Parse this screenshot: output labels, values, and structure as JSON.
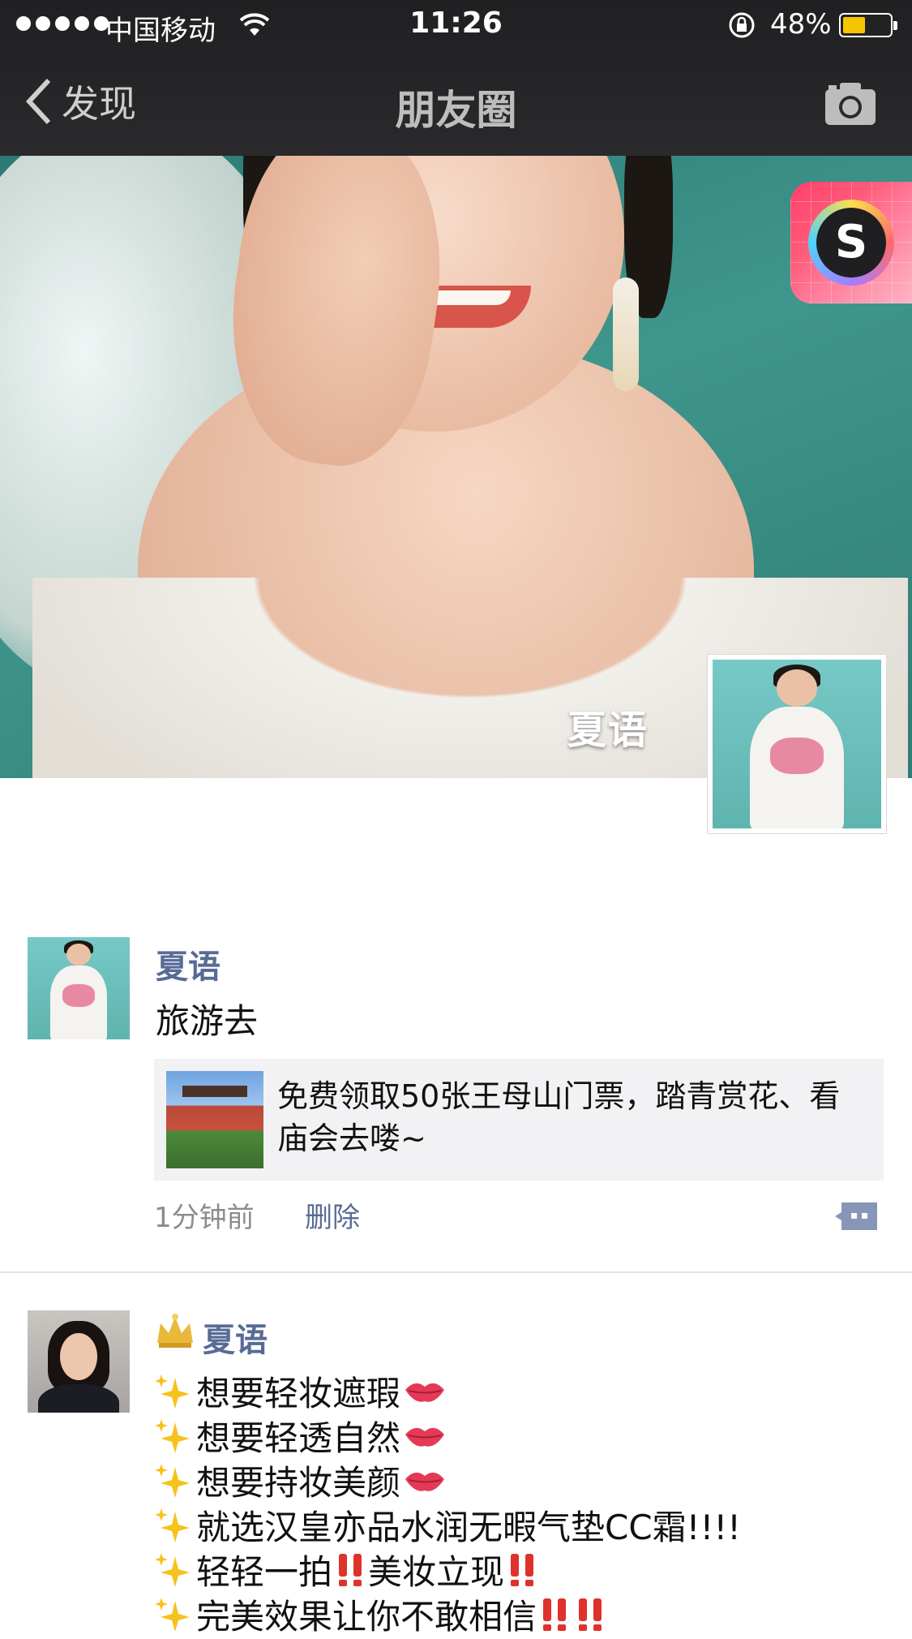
{
  "status_bar": {
    "carrier": "中国移动",
    "time": "11:26",
    "battery_percent": "48%",
    "battery_level": 0.48,
    "signal_dots": 5,
    "battery_color": "#f7c500"
  },
  "nav": {
    "back_label": "发现",
    "title": "朋友圈"
  },
  "cover": {
    "username": "夏语"
  },
  "app_badge": {
    "letter": "S"
  },
  "posts": [
    {
      "name": "夏语",
      "text": "旅游去",
      "link": {
        "title": "免费领取50张王母山门票，踏青赏花、看庙会去喽~"
      },
      "time": "1分钟前",
      "delete_label": "删除"
    },
    {
      "name": "夏语",
      "lines": [
        "想要轻妆遮瑕",
        "想要轻透自然",
        "想要持妆美颜",
        "就选汉皇亦品水润无暇气垫CC霜!!!!",
        "轻轻一拍",
        "美妆立现",
        "完美效果让你不敢相信"
      ]
    }
  ],
  "colors": {
    "link_blue": "#576b95",
    "nav_bg": "#242426",
    "cover_teal": "#3f968c"
  },
  "icons": [
    "wifi-icon",
    "lock-icon",
    "battery-icon",
    "back-chevron-icon",
    "camera-icon",
    "comment-icon",
    "crown-icon",
    "sparkle-icon",
    "kiss-icon",
    "double-exclamation-icon"
  ]
}
